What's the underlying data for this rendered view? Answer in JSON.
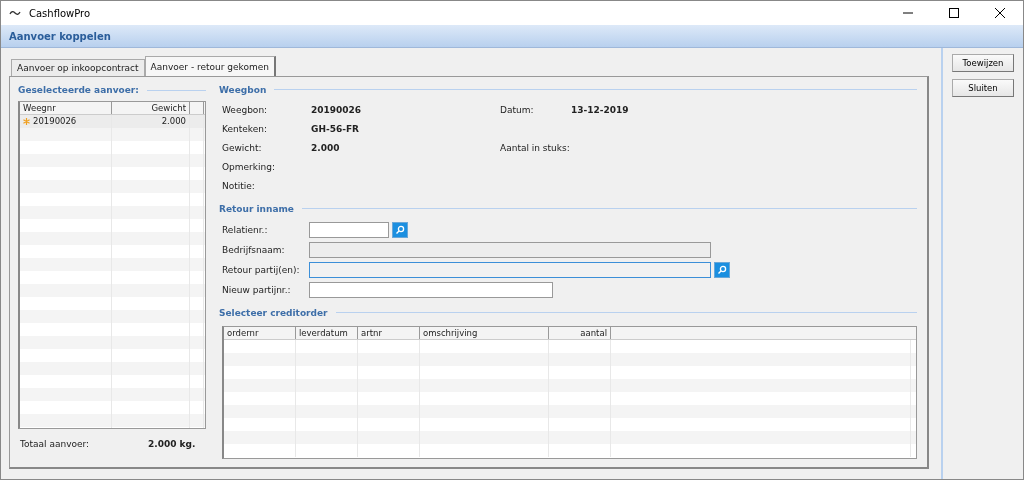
{
  "window": {
    "title": "CashflowPro"
  },
  "header": {
    "title": "Aanvoer koppelen"
  },
  "tabs": [
    {
      "label": "Aanvoer op inkoopcontract",
      "selected": false
    },
    {
      "label": "Aanvoer - retour gekomen",
      "selected": true
    }
  ],
  "buttons": [
    {
      "label": "Toewijzen"
    },
    {
      "label": "Sluiten"
    }
  ],
  "selected_supply": {
    "title": "Geselecteerde aanvoer:",
    "columns": [
      "Weegnr",
      "Gewicht"
    ],
    "rows": [
      {
        "weegnr": "20190026",
        "gewicht": "2.000",
        "current": true
      }
    ],
    "total_label": "Totaal aanvoer:",
    "total_value": "2.000 kg."
  },
  "weegbon": {
    "title": "Weegbon",
    "rows": [
      [
        {
          "label": "Weegbon:",
          "value": "20190026"
        },
        {
          "label": "Datum:",
          "value": "13-12-2019"
        }
      ],
      [
        {
          "label": "Kenteken:",
          "value": "GH-56-FR"
        }
      ],
      [
        {
          "label": "Gewicht:",
          "value": "2.000"
        },
        {
          "label": "Aantal in stuks:"
        }
      ],
      [
        {
          "label": "Opmerking:"
        }
      ],
      [
        {
          "label": "Notitie:"
        }
      ]
    ]
  },
  "retour": {
    "title": "Retour inname",
    "fields": [
      {
        "label": "Relatienr.:",
        "kind": "lookup",
        "disabled": false,
        "focused": false
      },
      {
        "label": "Bedrijfsnaam:",
        "kind": "text",
        "disabled": true,
        "focused": false
      },
      {
        "label": "Retour partij(en):",
        "kind": "lookup",
        "disabled": false,
        "focused": true
      },
      {
        "label": "Nieuw partijnr.:",
        "kind": "text",
        "disabled": false,
        "focused": false
      }
    ]
  },
  "creditorder": {
    "title": "Selecteer creditorder",
    "columns": [
      "ordernr",
      "leverdatum",
      "artnr",
      "omschrijving",
      "aantal"
    ]
  }
}
